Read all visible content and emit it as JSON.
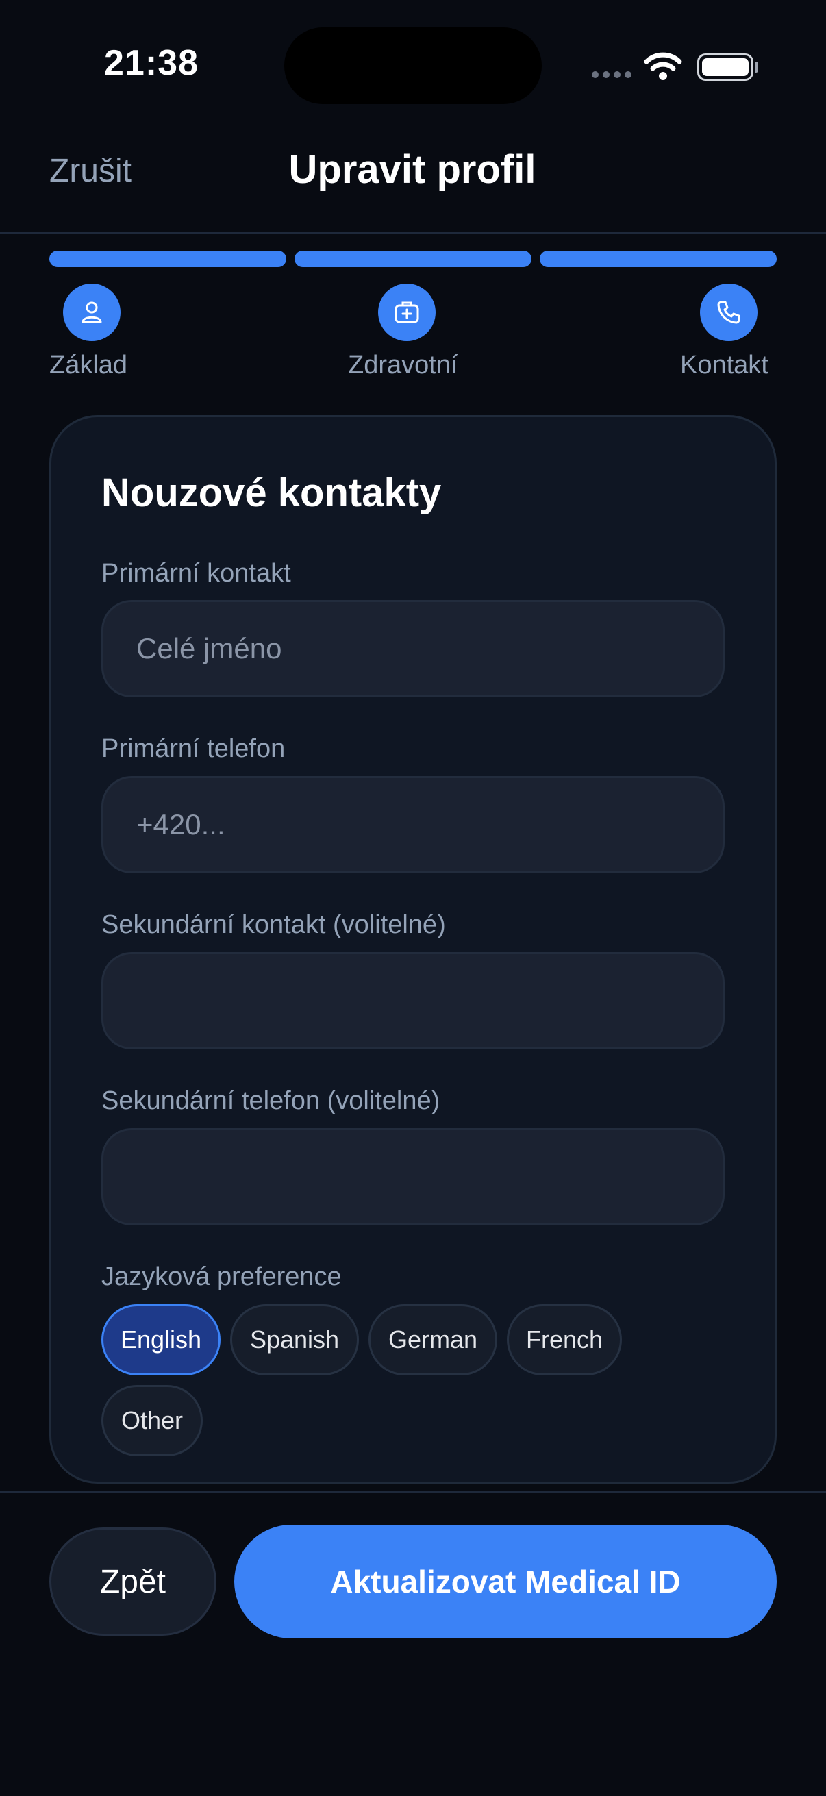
{
  "status_bar": {
    "time": "21:38",
    "icons": [
      "cellular-signal-icon",
      "wifi-icon",
      "battery-icon"
    ]
  },
  "header": {
    "cancel_label": "Zrušit",
    "title": "Upravit profil"
  },
  "steps": [
    {
      "label": "Základ",
      "icon": "person-icon"
    },
    {
      "label": "Zdravotní",
      "icon": "medical-kit-icon"
    },
    {
      "label": "Kontakt",
      "icon": "phone-icon"
    }
  ],
  "progress": {
    "completed_steps": 3,
    "total_steps": 3
  },
  "card": {
    "title": "Nouzové kontakty",
    "fields": [
      {
        "label": "Primární kontakt",
        "value": "",
        "placeholder": "Celé jméno"
      },
      {
        "label": "Primární telefon",
        "value": "",
        "placeholder": "+420..."
      },
      {
        "label": "Sekundární kontakt (volitelné)",
        "value": "",
        "placeholder": ""
      },
      {
        "label": "Sekundární telefon (volitelné)",
        "value": "",
        "placeholder": ""
      }
    ],
    "language": {
      "label": "Jazyková preference",
      "options": [
        "English",
        "Spanish",
        "German",
        "French",
        "Other"
      ],
      "selected": "English"
    }
  },
  "footer": {
    "back_label": "Zpět",
    "submit_label": "Aktualizovat Medical ID"
  },
  "colors": {
    "accent": "#3b82f6",
    "background": "#080b12",
    "card": "#0f1623",
    "selected_chip": "#1e3a8a"
  }
}
